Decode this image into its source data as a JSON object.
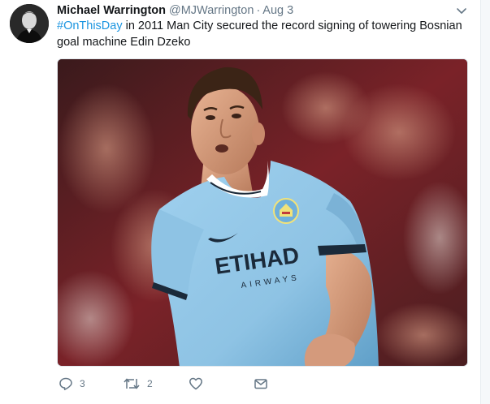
{
  "tweet": {
    "author_name": "Michael Warrington",
    "author_handle": "@MJWarrington",
    "separator": "·",
    "timestamp": "Aug 3",
    "hashtag": "#OnThisDay",
    "text": " in 2011 Man City secured the record signing of towering Bosnian goal machine Edin Dzeko"
  },
  "media": {
    "shirt_sponsor": "ETIHAD",
    "shirt_sponsor_sub": "AIRWAYS",
    "colors": {
      "shirt": "#8ec3e4",
      "shirt_shadow": "#5f9fc8",
      "background_red": "#7a2228",
      "background_dark": "#3a1a1c"
    }
  },
  "actions": {
    "reply_icon": "reply-icon",
    "reply_count": "3",
    "retweet_icon": "retweet-icon",
    "retweet_count": "2",
    "like_icon": "heart-icon",
    "dm_icon": "envelope-icon"
  },
  "colors": {
    "link": "#1b95e0",
    "secondary_text": "#657786",
    "primary_text": "#14171a"
  }
}
